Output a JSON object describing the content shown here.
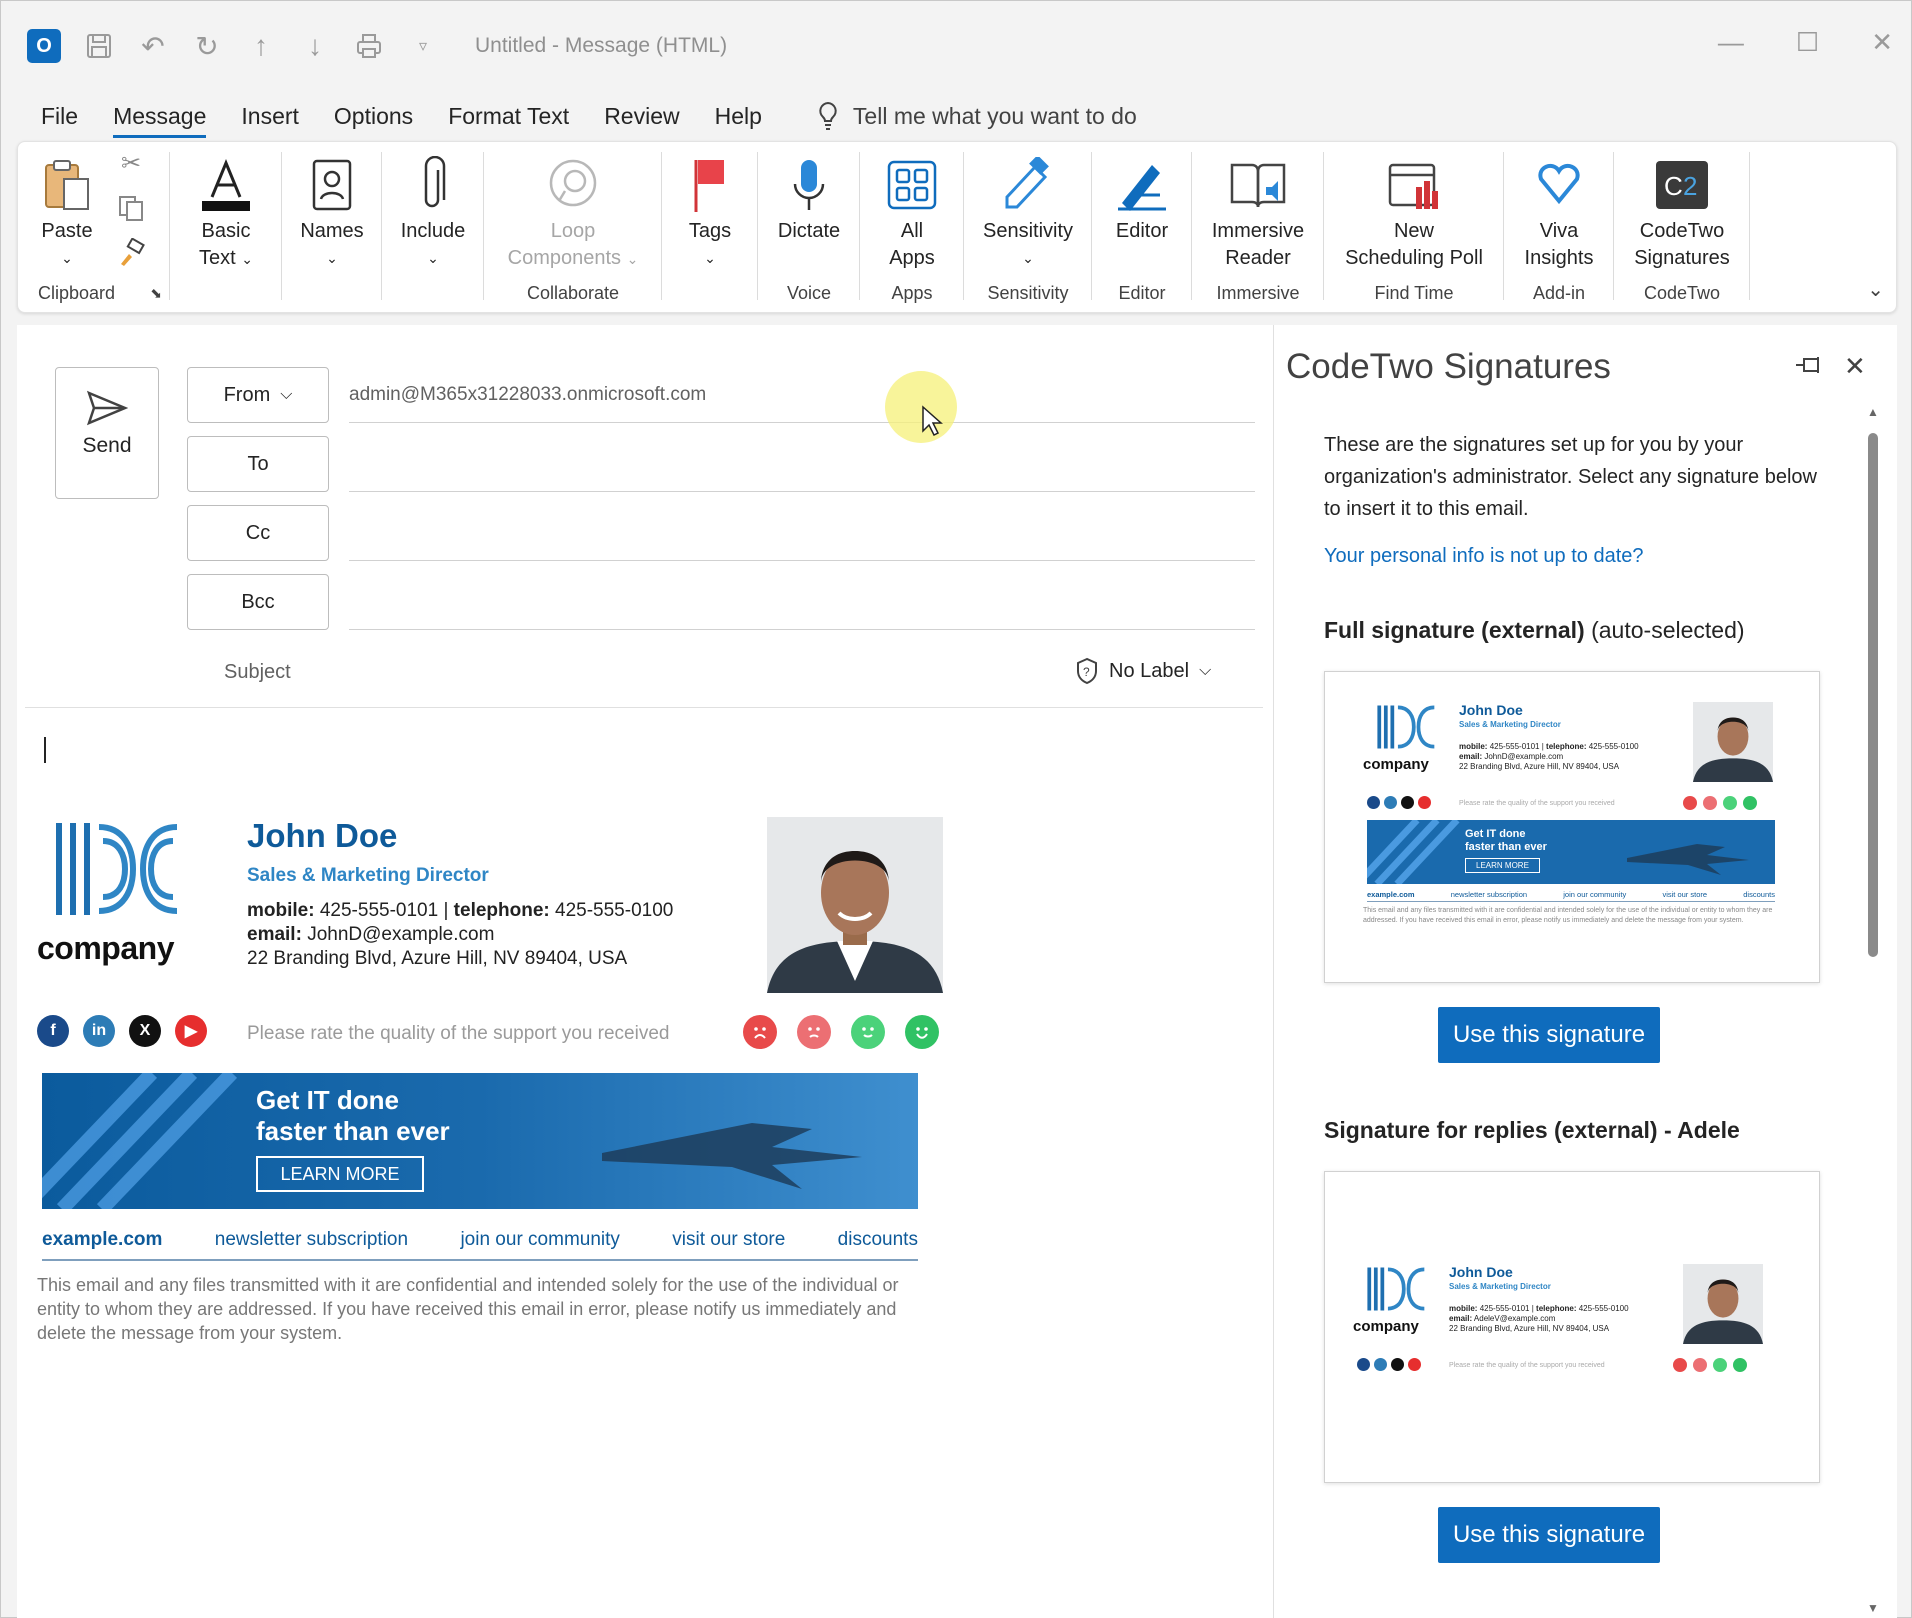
{
  "window": {
    "title": "Untitled  -  Message (HTML)",
    "app_icon": "outlook-icon"
  },
  "menu": {
    "tabs": [
      "File",
      "Message",
      "Insert",
      "Options",
      "Format Text",
      "Review",
      "Help"
    ],
    "active_tab": "Message",
    "tell_me": "Tell me what you want to do"
  },
  "ribbon": {
    "paste": "Paste",
    "basic_text_1": "Basic",
    "basic_text_2": "Text",
    "names": "Names",
    "include": "Include",
    "loop_1": "Loop",
    "loop_2": "Components",
    "tags": "Tags",
    "dictate": "Dictate",
    "all_apps_1": "All",
    "all_apps_2": "Apps",
    "sensitivity": "Sensitivity",
    "editor": "Editor",
    "immersive_1": "Immersive",
    "immersive_2": "Reader",
    "new_poll_1": "New",
    "new_poll_2": "Scheduling Poll",
    "viva_1": "Viva",
    "viva_2": "Insights",
    "codetwo_1": "CodeTwo",
    "codetwo_2": "Signatures",
    "groups": {
      "clipboard": "Clipboard",
      "collaborate": "Collaborate",
      "voice": "Voice",
      "apps": "Apps",
      "sensitivity": "Sensitivity",
      "editor": "Editor",
      "immersive": "Immersive",
      "find_time": "Find Time",
      "add_in": "Add-in",
      "codetwo": "CodeTwo"
    }
  },
  "compose": {
    "send": "Send",
    "from_label": "From",
    "from_value": "admin@M365x31228033.onmicrosoft.com",
    "to_label": "To",
    "cc_label": "Cc",
    "bcc_label": "Bcc",
    "subject_label": "Subject",
    "sensitivity_label": "No Label"
  },
  "signature": {
    "company": "company",
    "name": "John Doe",
    "title": "Sales & Marketing Director",
    "mobile_label": "mobile:",
    "mobile": "425-555-0101",
    "separator": " | ",
    "telephone_label": "telephone:",
    "telephone": "425-555-0100",
    "email_label": "email:",
    "email": "JohnD@example.com",
    "address": "22 Branding Blvd, Azure Hill, NV 89404, USA",
    "rate_text": "Please rate the quality of the support you received",
    "banner_line1": "Get IT done",
    "banner_line2": "faster than ever",
    "banner_button": "LEARN MORE",
    "links": [
      "example.com",
      "newsletter subscription",
      "join our community",
      "visit our store",
      "discounts"
    ],
    "disclaimer": "This email and any files transmitted with it are confidential and intended solely for the use of the individual or entity to whom they are addressed. If you have received this email in error, please notify us immediately and delete the message from your system."
  },
  "sidepane": {
    "title": "CodeTwo Signatures",
    "intro": "These are the signatures set up for you by your organization's administrator. Select any signature below to insert it to this email.",
    "personal_info_link": "Your personal info is not up to date?",
    "sig1_title": "Full signature (external)",
    "sig1_suffix": " (auto-selected)",
    "sig2_title": "Signature for replies (external) - Adele",
    "use_button": "Use this signature",
    "mini_email_1": "JohnD@example.com",
    "mini_email_2": "AdeleV@example.com"
  },
  "colors": {
    "accent": "#0f6cbd",
    "brand_blue": "#0e5a99",
    "light_blue": "#2f86c5"
  }
}
